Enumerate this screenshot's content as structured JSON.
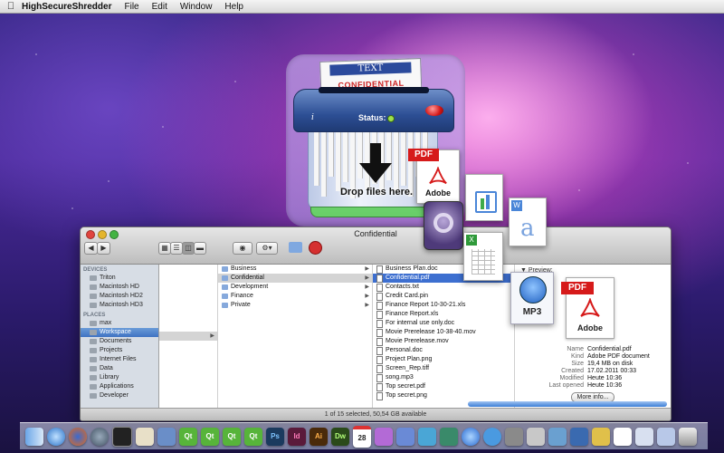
{
  "menubar": {
    "app_name": "HighSecureShredder",
    "items": [
      "File",
      "Edit",
      "Window",
      "Help"
    ]
  },
  "shredder": {
    "paper_band": "TEXT",
    "paper_label": "CONFIDENTIAL",
    "info_glyph": "i",
    "status_label": "Status:",
    "drop_text": "Drop files here."
  },
  "finder": {
    "title": "Confidential",
    "sidebar": {
      "devices_header": "DEVICES",
      "devices": [
        "Triton",
        "Macintosh HD",
        "Macintosh HD2",
        "Macintosh HD3"
      ],
      "places_header": "PLACES",
      "places": [
        "max",
        "Workspace",
        "Documents",
        "Projects",
        "Internet Files",
        "Data",
        "Library",
        "Applications",
        "Developer"
      ]
    },
    "col1": [
      "Business",
      "Confidential",
      "Development",
      "Finance",
      "Private"
    ],
    "col2": [
      "Business Plan.doc",
      "Confidential.pdf",
      "Contacts.txt",
      "Credit Card.pin",
      "Finance Report 10-30-21.xls",
      "Finance Report.xls",
      "For internal use only.doc",
      "Movie Prerelease 10-38-40.mov",
      "Movie Prerelease.mov",
      "Personal.doc",
      "Project Plan.png",
      "Screen_Rep.tiff",
      "song.mp3",
      "Top secret.pdf",
      "Top secret.png"
    ],
    "preview_label": "Preview:",
    "meta": [
      {
        "k": "Name",
        "v": "Confidential.pdf"
      },
      {
        "k": "Kind",
        "v": "Adobe PDF document"
      },
      {
        "k": "Size",
        "v": "19,4 MB on disk"
      },
      {
        "k": "Created",
        "v": "17.02.2011 00:33"
      },
      {
        "k": "Modified",
        "v": "Heute 10:36"
      },
      {
        "k": "Last opened",
        "v": "Heute 10:36"
      }
    ],
    "more_info": "More info...",
    "status": "1 of 15 selected, 50,54 GB available"
  },
  "icons": {
    "pdf_tag": "PDF",
    "adobe": "Adobe",
    "mp3": "MP3"
  },
  "dock": {
    "labels": [
      "Qt",
      "Qt",
      "Qt",
      "Qt",
      "Ps",
      "Id",
      "Ai",
      "Dw",
      "28"
    ]
  }
}
